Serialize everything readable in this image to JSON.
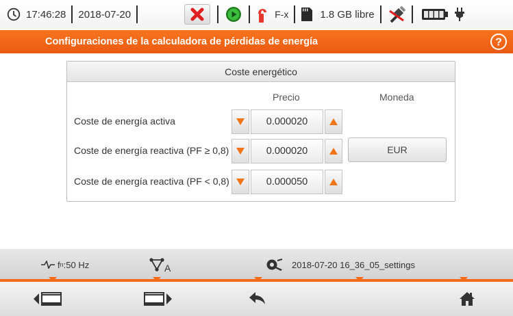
{
  "status": {
    "time": "17:46:28",
    "date": "2018-07-20",
    "clamp_label": "F-x",
    "storage": "1.8 GB libre"
  },
  "title": {
    "text": "Configuraciones de la calculadora de pérdidas de energía"
  },
  "panel": {
    "header": "Coste energético",
    "col_price": "Precio",
    "col_currency": "Moneda",
    "rows": [
      {
        "label": "Coste de energía activa",
        "value": "0.000020"
      },
      {
        "label": "Coste de energía reactiva (PF ≥ 0,8)",
        "value": "0.000020"
      },
      {
        "label": "Coste de energía reactiva (PF < 0,8)",
        "value": "0.000050"
      }
    ],
    "currency": "EUR"
  },
  "infobar": {
    "frequency_prefix": "f",
    "frequency_sub": "n",
    "frequency_value": ":50 Hz",
    "phase_sub": "A",
    "settings_file": "2018-07-20 16_36_05_settings"
  },
  "colors": {
    "accent": "#f26b1a",
    "arrow": "#f07418",
    "close_red": "#e02020",
    "play_green": "#2aa32a"
  },
  "icons": [
    "clock-icon",
    "close-icon",
    "play-icon",
    "clamp-icon",
    "sd-card-icon",
    "usb-icon",
    "battery-icon",
    "plug-icon",
    "help-icon",
    "waveform-icon",
    "phase-triangle-icon",
    "settings-file-icon",
    "screen-back-icon",
    "screen-forward-icon",
    "return-arrow-icon",
    "home-icon"
  ]
}
